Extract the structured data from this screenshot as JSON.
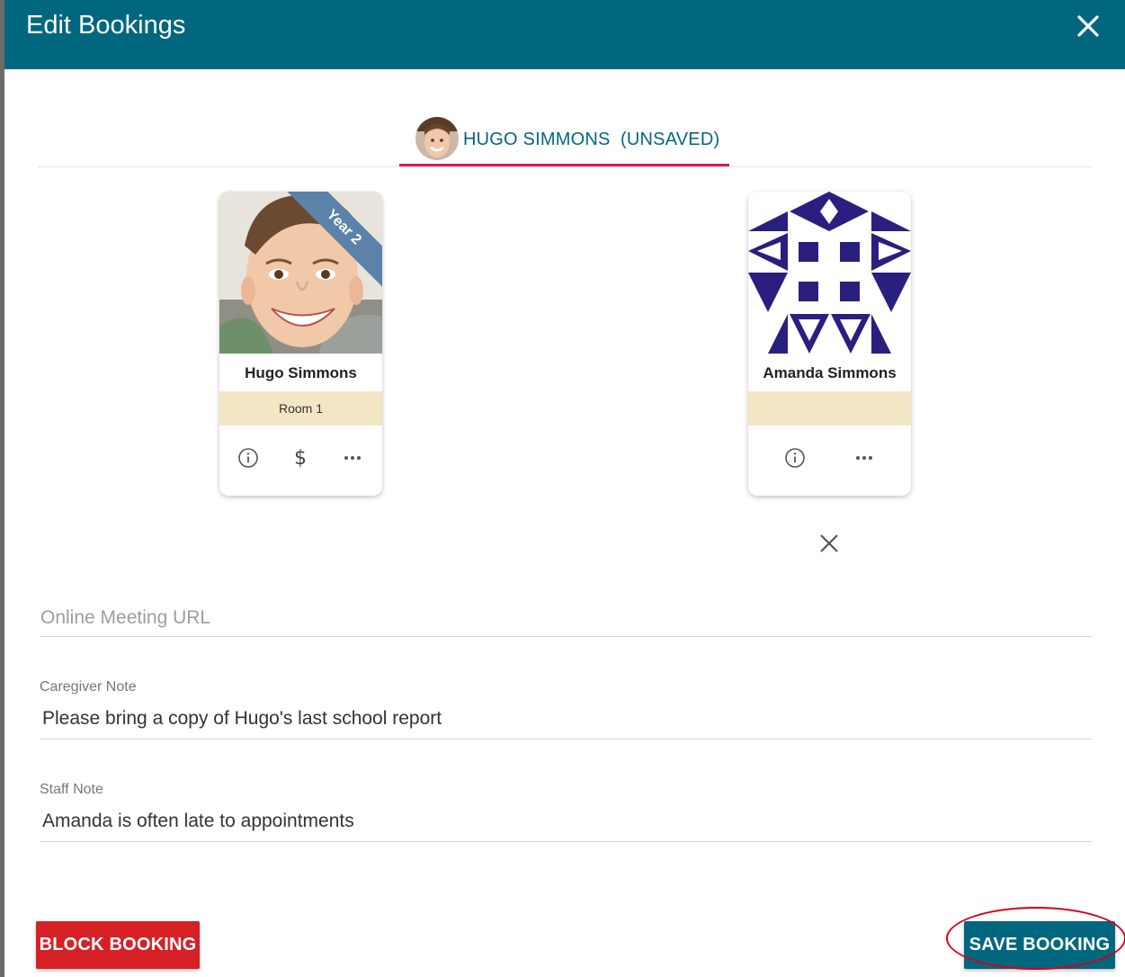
{
  "dialog": {
    "title": "Edit Bookings",
    "close_icon": "close-icon"
  },
  "tab": {
    "label": "HUGO SIMMONS  (UNSAVED)",
    "accent_color": "#d81b60"
  },
  "cards": [
    {
      "name": "Hugo Simmons",
      "room": "Room 1",
      "ribbon": "Year 2",
      "actions": [
        "info-icon",
        "dollar-icon",
        "more-icon"
      ]
    },
    {
      "name": "Amanda Simmons",
      "room": "",
      "actions": [
        "info-icon",
        "more-icon"
      ]
    }
  ],
  "fields": {
    "online_meeting_url": {
      "placeholder": "Online Meeting URL",
      "value": ""
    },
    "caregiver_note": {
      "label": "Caregiver Note",
      "value": "Please bring a copy of Hugo's last school report"
    },
    "staff_note": {
      "label": "Staff Note",
      "value": "Amanda is often late to appointments"
    }
  },
  "buttons": {
    "block_booking": "BLOCK BOOKING",
    "save_booking": "SAVE BOOKING"
  },
  "colors": {
    "header": "#00677f",
    "block_button": "#d62026",
    "save_button": "#00677f",
    "room_band": "#f3e6c4",
    "ribbon": "#5b82a8",
    "identicon": "#2a1f7f"
  }
}
